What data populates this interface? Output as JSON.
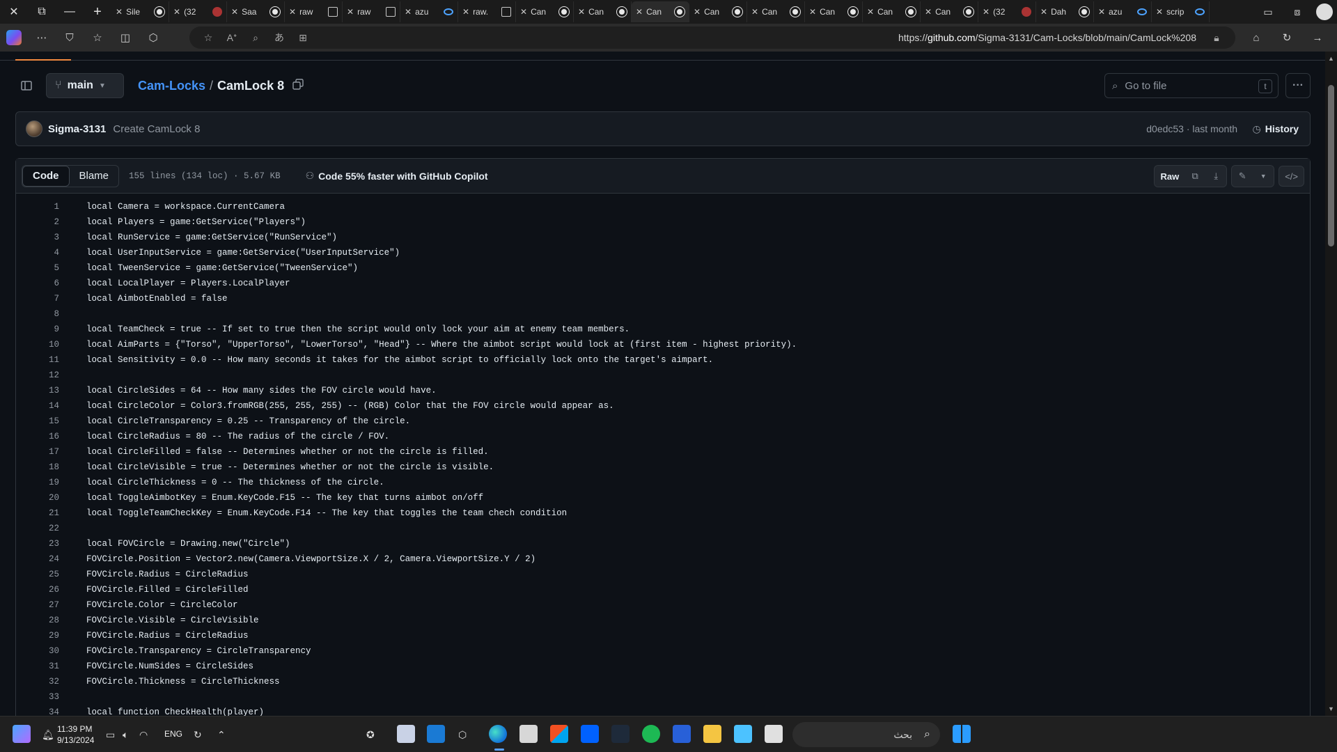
{
  "browser": {
    "tabs": [
      {
        "title": "Sile",
        "icon": "github"
      },
      {
        "title": "(32",
        "icon": "youtube"
      },
      {
        "title": "Saa",
        "icon": "github"
      },
      {
        "title": "raw",
        "icon": "document"
      },
      {
        "title": "raw",
        "icon": "document"
      },
      {
        "title": "azu",
        "icon": "search"
      },
      {
        "title": "raw.",
        "icon": "document"
      },
      {
        "title": "Can",
        "icon": "github"
      },
      {
        "title": "Can",
        "icon": "github"
      },
      {
        "title": "Can",
        "icon": "github",
        "active": true
      },
      {
        "title": "Can",
        "icon": "github"
      },
      {
        "title": "Can",
        "icon": "github"
      },
      {
        "title": "Can",
        "icon": "github"
      },
      {
        "title": "Can",
        "icon": "github"
      },
      {
        "title": "Can",
        "icon": "github"
      },
      {
        "title": "(32",
        "icon": "youtube"
      },
      {
        "title": "Dah",
        "icon": "github"
      },
      {
        "title": "azu",
        "icon": "search"
      },
      {
        "title": "scrip",
        "icon": "search"
      }
    ],
    "address": {
      "prefix": "https://",
      "host": "github.com",
      "path": "/Sigma-3131/Cam-Locks/blob/main/CamLock%208"
    }
  },
  "repo": {
    "branch": "main",
    "repo_name": "Cam-Locks",
    "separator": "/",
    "file_name": "CamLock 8",
    "goto_placeholder": "Go to file",
    "goto_shortcut": "t"
  },
  "commit": {
    "author": "Sigma-3131",
    "message": "Create CamLock 8",
    "meta": "d0edc53 · last month",
    "history_label": "History"
  },
  "file": {
    "tabs": {
      "code": "Code",
      "blame": "Blame"
    },
    "stats": "155 lines (134 loc) · 5.67 KB",
    "copilot_promo": "Code 55% faster with GitHub Copilot",
    "raw_label": "Raw",
    "lines": [
      "local Camera = workspace.CurrentCamera",
      "local Players = game:GetService(\"Players\")",
      "local RunService = game:GetService(\"RunService\")",
      "local UserInputService = game:GetService(\"UserInputService\")",
      "local TweenService = game:GetService(\"TweenService\")",
      "local LocalPlayer = Players.LocalPlayer",
      "local AimbotEnabled = false",
      "",
      "local TeamCheck = true -- If set to true then the script would only lock your aim at enemy team members.",
      "local AimParts = {\"Torso\", \"UpperTorso\", \"LowerTorso\", \"Head\"} -- Where the aimbot script would lock at (first item - highest priority).",
      "local Sensitivity = 0.0 -- How many seconds it takes for the aimbot script to officially lock onto the target's aimpart.",
      "",
      "local CircleSides = 64 -- How many sides the FOV circle would have.",
      "local CircleColor = Color3.fromRGB(255, 255, 255) -- (RGB) Color that the FOV circle would appear as.",
      "local CircleTransparency = 0.25 -- Transparency of the circle.",
      "local CircleRadius = 80 -- The radius of the circle / FOV.",
      "local CircleFilled = false -- Determines whether or not the circle is filled.",
      "local CircleVisible = true -- Determines whether or not the circle is visible.",
      "local CircleThickness = 0 -- The thickness of the circle.",
      "local ToggleAimbotKey = Enum.KeyCode.F15 -- The key that turns aimbot on/off",
      "local ToggleTeamCheckKey = Enum.KeyCode.F14 -- The key that toggles the team chech condition",
      "",
      "local FOVCircle = Drawing.new(\"Circle\")",
      "FOVCircle.Position = Vector2.new(Camera.ViewportSize.X / 2, Camera.ViewportSize.Y / 2)",
      "FOVCircle.Radius = CircleRadius",
      "FOVCircle.Filled = CircleFilled",
      "FOVCircle.Color = CircleColor",
      "FOVCircle.Visible = CircleVisible",
      "FOVCircle.Radius = CircleRadius",
      "FOVCircle.Transparency = CircleTransparency",
      "FOVCircle.NumSides = CircleSides",
      "FOVCircle.Thickness = CircleThickness",
      "",
      "local function CheckHealth(player)"
    ]
  },
  "taskbar": {
    "time": "11:39 PM",
    "date": "9/13/2024",
    "language": "ENG",
    "search_placeholder": "بحث"
  },
  "colors": {
    "link": "#4493f8",
    "bg": "#0d1117",
    "panel": "#161b22",
    "border": "#30363d",
    "accent": "#f0883e"
  }
}
